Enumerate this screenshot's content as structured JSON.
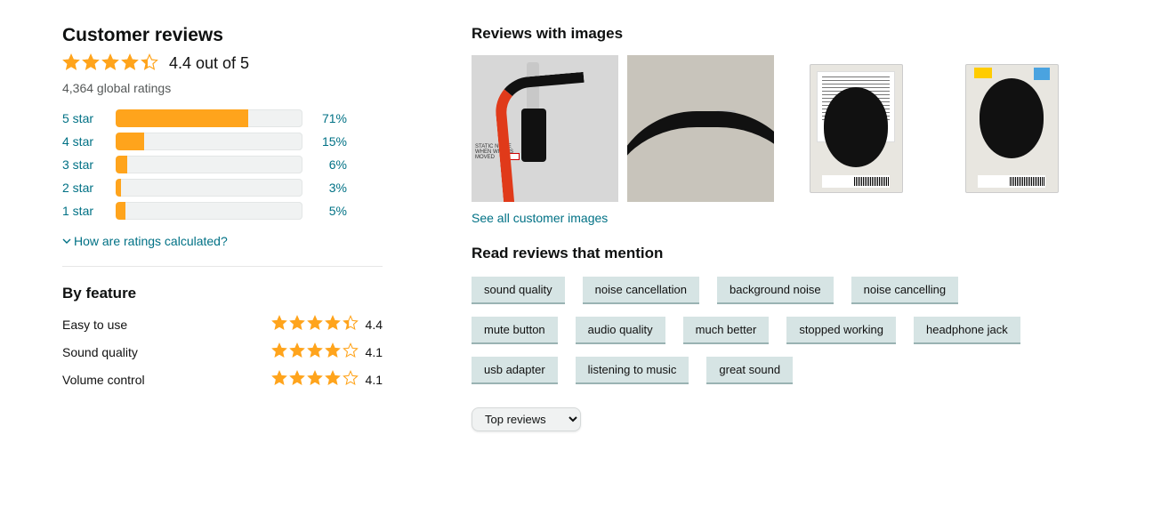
{
  "left": {
    "title": "Customer reviews",
    "overall_rating": 4.4,
    "rating_text": "4.4 out of 5",
    "global_ratings_text": "4,364 global ratings",
    "histogram": [
      {
        "label": "5 star",
        "pct": 71,
        "pct_text": "71%"
      },
      {
        "label": "4 star",
        "pct": 15,
        "pct_text": "15%"
      },
      {
        "label": "3 star",
        "pct": 6,
        "pct_text": "6%"
      },
      {
        "label": "2 star",
        "pct": 3,
        "pct_text": "3%"
      },
      {
        "label": "1 star",
        "pct": 5,
        "pct_text": "5%"
      }
    ],
    "how_calculated": "How are ratings calculated?",
    "by_feature_title": "By feature",
    "features": [
      {
        "name": "Easy to use",
        "rating": 4.4,
        "rating_text": "4.4"
      },
      {
        "name": "Sound quality",
        "rating": 4.1,
        "rating_text": "4.1"
      },
      {
        "name": "Volume control",
        "rating": 4.1,
        "rating_text": "4.1"
      }
    ]
  },
  "right": {
    "reviews_with_images_title": "Reviews with images",
    "see_all_images": "See all customer images",
    "mention_title": "Read reviews that mention",
    "tags": [
      "sound quality",
      "noise cancellation",
      "background noise",
      "noise cancelling",
      "mute button",
      "audio quality",
      "much better",
      "stopped working",
      "headphone jack",
      "usb adapter",
      "listening to music",
      "great sound"
    ],
    "sort_selected": "Top reviews"
  }
}
